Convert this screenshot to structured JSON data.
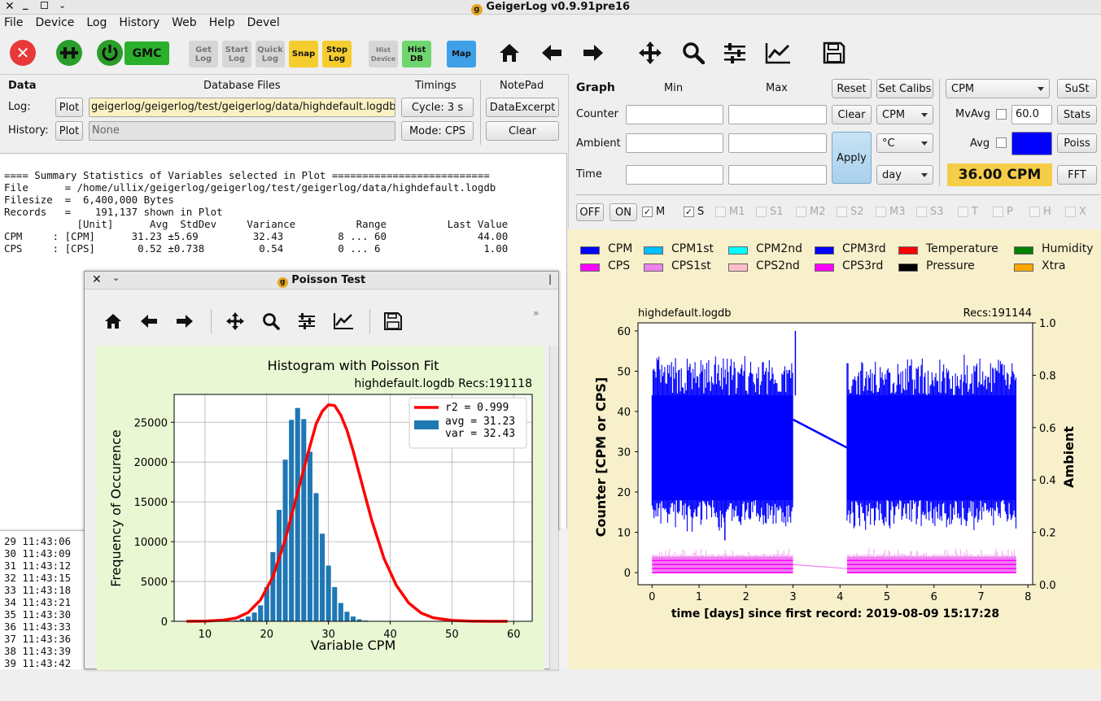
{
  "window": {
    "title": "GeigerLog v0.9.91pre16"
  },
  "menu": [
    "File",
    "Device",
    "Log",
    "History",
    "Web",
    "Help",
    "Devel"
  ],
  "toolbar": {
    "gmc_label": "GMC",
    "buttons": [
      {
        "line1": "Get",
        "line2": "Log"
      },
      {
        "line1": "Start",
        "line2": "Log"
      },
      {
        "line1": "Quick",
        "line2": "Log"
      },
      {
        "line1": "Snap",
        "line2": ""
      },
      {
        "line1": "Stop",
        "line2": "Log"
      },
      {
        "line1": "Hist",
        "line2": "Device"
      },
      {
        "line1": "Hist",
        "line2": "DB"
      },
      {
        "line1": "Map",
        "line2": ""
      }
    ]
  },
  "data_panel": {
    "title": "Data",
    "db_files_label": "Database Files",
    "timings_label": "Timings",
    "notepad_label": "NotePad",
    "log_label": "Log:",
    "history_label": "History:",
    "plot_label": "Plot",
    "log_file_value": "geigerlog/geigerlog/test/geigerlog/data/highdefault.logdb",
    "history_file_value": "None",
    "cycle_label": "Cycle: 3 s",
    "mode_label": "Mode: CPS",
    "data_excerpt_label": "DataExcerpt",
    "clear_label": "Clear"
  },
  "notepad_text": "\n==== Summary Statistics of Variables selected in Plot ==========================\nFile      = /home/ullix/geigerlog/geigerlog/test/geigerlog/data/highdefault.logdb\nFilesize  =  6,400,000 Bytes\nRecords   =    191,137 shown in Plot\n            [Unit]      Avg  StdDev     Variance          Range          Last Value\nCPM     : [CPM]      31.23 ±5.69         32.43         8 ... 60               44.00\nCPS     : [CPS]       0.52 ±0.738         0.54         0 ... 6                 1.00",
  "log_lines": [
    "29 11:43:06",
    "30 11:43:09",
    "31 11:43:12",
    "32 11:43:15",
    "33 11:43:18",
    "34 11:43:21",
    "35 11:43:30",
    "36 11:43:33",
    "37 11:43:36",
    "38 11:43:39",
    "39 11:43:42"
  ],
  "graph_panel": {
    "title": "Graph",
    "min_label": "Min",
    "max_label": "Max",
    "reset_label": "Reset",
    "set_calibs_label": "Set Calibs",
    "counter_label": "Counter",
    "ambient_label": "Ambient",
    "time_label": "Time",
    "clear_label": "Clear",
    "apply_label": "Apply",
    "counter_unit": "CPM",
    "ambient_unit": "°C",
    "time_unit": "day",
    "variable_select": "CPM",
    "sust_label": "SuSt",
    "mvavg_label": "MvAvg",
    "mvavg_value": "60.0",
    "stats_label": "Stats",
    "avg_label": "Avg",
    "poiss_label": "Poiss",
    "cpm_display": "36.00 CPM",
    "fft_label": "FFT",
    "off_label": "OFF",
    "on_label": "ON",
    "checks": [
      {
        "label": "M",
        "checked": true,
        "enabled": true
      },
      {
        "label": "S",
        "checked": true,
        "enabled": true
      },
      {
        "label": "M1",
        "checked": false,
        "enabled": false
      },
      {
        "label": "S1",
        "checked": false,
        "enabled": false
      },
      {
        "label": "M2",
        "checked": false,
        "enabled": false
      },
      {
        "label": "S2",
        "checked": false,
        "enabled": false
      },
      {
        "label": "M3",
        "checked": false,
        "enabled": false
      },
      {
        "label": "S3",
        "checked": false,
        "enabled": false
      },
      {
        "label": "T",
        "checked": false,
        "enabled": false
      },
      {
        "label": "P",
        "checked": false,
        "enabled": false
      },
      {
        "label": "H",
        "checked": false,
        "enabled": false
      },
      {
        "label": "X",
        "checked": false,
        "enabled": false
      }
    ],
    "avg_color": "#0000ff",
    "cpm_display_bg": "#f5cd48"
  },
  "legend": [
    {
      "label": "CPM",
      "color": "#0000ff"
    },
    {
      "label": "CPM1st",
      "color": "#00bfff"
    },
    {
      "label": "CPM2nd",
      "color": "#00ffff"
    },
    {
      "label": "CPM3rd",
      "color": "#0000ff"
    },
    {
      "label": "Temperature",
      "color": "#ff0000"
    },
    {
      "label": "Humidity",
      "color": "#008000"
    },
    {
      "label": "CPS",
      "color": "#ff00ff"
    },
    {
      "label": "CPS1st",
      "color": "#ee82ee"
    },
    {
      "label": "CPS2nd",
      "color": "#ffc0cb"
    },
    {
      "label": "CPS3rd",
      "color": "#ff00ff"
    },
    {
      "label": "Pressure",
      "color": "#000000"
    },
    {
      "label": "Xtra",
      "color": "#ffa500"
    }
  ],
  "poisson_window": {
    "title": "Poisson Test"
  },
  "chart_data": [
    {
      "type": "bar",
      "title": "Histogram with Poisson Fit",
      "subtitle": "highdefault.logdb   Recs:191118",
      "xlabel": "Variable CPM",
      "ylabel": "Frequency of Occurence",
      "xlim": [
        5,
        63
      ],
      "ylim": [
        0,
        28500
      ],
      "xticks": [
        10,
        20,
        30,
        40,
        50,
        60
      ],
      "yticks": [
        0,
        5000,
        10000,
        15000,
        20000,
        25000
      ],
      "grid": true,
      "legend_position": "top-right",
      "legend": [
        "r2  = 0.999",
        "avg = 31.23",
        "var = 32.43"
      ],
      "bar_color": "#1f77b4",
      "fit_color": "#ff0000",
      "x": [
        8,
        9,
        10,
        11,
        12,
        13,
        14,
        15,
        16,
        17,
        18,
        19,
        20,
        21,
        22,
        23,
        24,
        25,
        26,
        27,
        28,
        29,
        30,
        31,
        32,
        33,
        34,
        35,
        36,
        37,
        38,
        39,
        40,
        41,
        42,
        43,
        44,
        45,
        46,
        47,
        48,
        49,
        50,
        51,
        52,
        53,
        54,
        55,
        56,
        57,
        58,
        59,
        60
      ],
      "values": [
        0,
        0,
        0,
        0,
        0,
        0,
        0,
        100,
        300,
        600,
        1100,
        2000,
        4300,
        8700,
        14000,
        20300,
        25300,
        26800,
        25400,
        21300,
        16100,
        11000,
        7000,
        4300,
        2300,
        1200,
        600,
        250,
        100,
        40,
        10,
        0,
        0,
        0,
        0,
        0,
        0,
        0,
        0,
        0,
        0,
        0,
        0,
        0,
        0,
        0,
        0,
        0,
        0,
        0,
        0,
        0,
        0
      ],
      "fit_x": [
        7,
        10,
        13,
        15,
        17,
        19,
        21,
        23,
        25,
        27,
        28,
        29,
        30,
        31,
        32,
        33,
        34,
        35,
        37,
        39,
        41,
        43,
        45,
        47,
        50,
        53,
        56,
        59
      ],
      "fit_y": [
        0,
        20,
        150,
        400,
        1100,
        2700,
        5600,
        10300,
        16200,
        22000,
        24800,
        26400,
        27200,
        27100,
        25900,
        24000,
        21400,
        18500,
        12700,
        7900,
        4500,
        2300,
        1050,
        440,
        110,
        20,
        4,
        0
      ]
    },
    {
      "type": "line",
      "title": "highdefault.logdb",
      "subtitle": "Recs:191144",
      "xlabel": "time [days] since first record: 2019-08-09 15:17:28",
      "ylabel": "Counter  [CPM or CPS]",
      "y2label": "Ambient",
      "xlim": [
        -0.3,
        8.1
      ],
      "ylim": [
        -3,
        62
      ],
      "y2lim": [
        0,
        1.0
      ],
      "xticks": [
        0,
        1,
        2,
        3,
        4,
        5,
        6,
        7,
        8
      ],
      "yticks": [
        0,
        10,
        20,
        30,
        40,
        50,
        60
      ],
      "y2ticks": [
        0.0,
        0.2,
        0.4,
        0.6,
        0.8,
        1.0
      ],
      "grid": false,
      "series": [
        {
          "name": "CPM",
          "color": "#0000ff",
          "segments": [
            {
              "x0": 0,
              "x1": 3.0,
              "ymin": 10,
              "ymax": 55,
              "mean": 31
            },
            {
              "x0": 4.15,
              "x1": 7.75,
              "ymin": 10,
              "ymax": 55,
              "mean": 31
            }
          ],
          "gap_line": [
            [
              3.0,
              38
            ],
            [
              4.15,
              31
            ]
          ],
          "peak": [
            3.05,
            60
          ],
          "low": [
            1.55,
            8
          ]
        },
        {
          "name": "CPS",
          "color": "#ff00ff",
          "segments": [
            {
              "x0": 0,
              "x1": 3.0,
              "ymin": 0,
              "ymax": 6,
              "mean": 0.5
            },
            {
              "x0": 4.15,
              "x1": 7.75,
              "ymin": 0,
              "ymax": 6,
              "mean": 0.5
            }
          ],
          "gap_line": [
            [
              3.0,
              2
            ],
            [
              4.15,
              1
            ]
          ]
        }
      ]
    }
  ]
}
